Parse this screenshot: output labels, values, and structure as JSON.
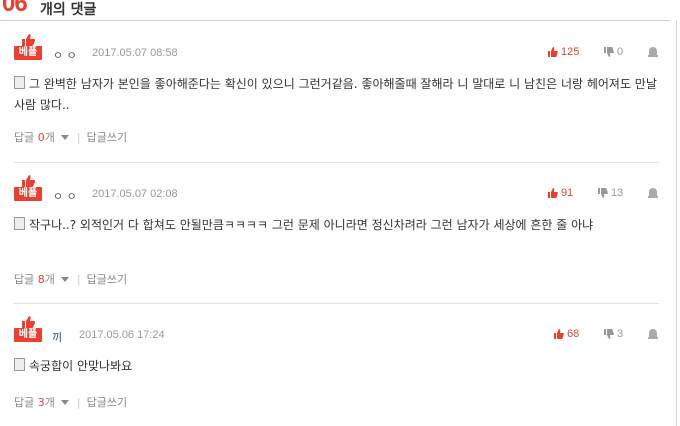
{
  "header": {
    "count": "06",
    "suffix": "개의 댓글"
  },
  "comments": [
    {
      "badge": "베플",
      "author": "ㅇ ㅇ",
      "date": "2017.05.07 08:58",
      "likes": "125",
      "dislikes": "0",
      "body": "그 완벽한 남자가 본인을 좋아해준다는 확신이 있으니 그런거같음. 좋아해줄때 잘해라 니 말대로 니 남친은 너랑 헤어져도 만날 사람 많다..",
      "reply_label": "답글",
      "reply_count": "0",
      "reply_unit": "개",
      "write_label": "답글쓰기"
    },
    {
      "badge": "베플",
      "author": "ㅇ ㅇ",
      "date": "2017.05.07 02:08",
      "likes": "91",
      "dislikes": "13",
      "body": "작구나..? 외적인거 다 합쳐도 안될만큼ㅋㅋㅋㅋ 그런 문제 아니라면 정신차려라 그런 남자가 세상에 흔한 줄 아냐",
      "reply_label": "답글",
      "reply_count": "8",
      "reply_unit": "개",
      "write_label": "답글쓰기"
    },
    {
      "badge": "베플",
      "author": "끼",
      "date": "2017.05.06 17:24",
      "likes": "68",
      "dislikes": "3",
      "body": "속궁합이 안맞나봐요",
      "reply_label": "답글",
      "reply_count": "3",
      "reply_unit": "개",
      "write_label": "답글쓰기"
    }
  ]
}
